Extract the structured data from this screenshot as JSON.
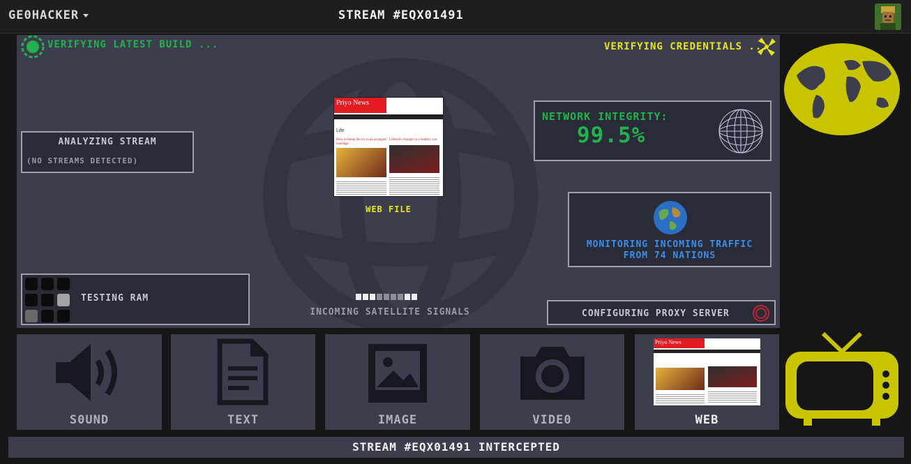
{
  "header": {
    "brand": "GE0HACKER",
    "stream_title": "STREAM #EQX01491"
  },
  "main": {
    "build_status": "VERIFYING LATEST BUILD ...",
    "credentials_status": "VERIFYING CREDENTIALS ...",
    "analyze": {
      "title": "ANALYZING STREAM",
      "detail": "(NO STREAMS DETECTED)"
    },
    "web_file": {
      "label": "WEB FILE",
      "thumb": {
        "site": "Priyo News",
        "section": "Life",
        "headline_1": "How to break the ice in an arranged marriage",
        "headline_2": "Lifestyle changes to a healthy you"
      }
    },
    "network": {
      "label": "NETWORK INTEGRITY:",
      "value": "99.5%"
    },
    "monitor": {
      "line1": "MONITORING INCOMING TRAFFIC",
      "line2": "FROM 74 NATIONS"
    },
    "ram": {
      "label": "TESTING RAM"
    },
    "satellite": {
      "label": "INCOMING SATELLITE SIGNALS"
    },
    "proxy": {
      "label": "CONFIGURING PROXY SERVER"
    }
  },
  "media": {
    "sound": "S0UND",
    "text": "TEXT",
    "image": "IMAGE",
    "video": "VIDE0",
    "web": "WEB"
  },
  "footer": {
    "status": "STREAM #EQX01491 INTERCEPTED"
  },
  "colors": {
    "green": "#22b14c",
    "yellow": "#e6e61a",
    "blue": "#3a8fe8",
    "panel": "#3c3d4d",
    "accent_olive": "#c8c400"
  },
  "icons": {
    "build": "spinning-globe-icon",
    "credentials": "fan-icon",
    "network": "wireframe-sphere-icon",
    "monitor": "earth-icon",
    "proxy": "ring-icon",
    "sound": "speaker-icon",
    "text": "document-icon",
    "image": "picture-icon",
    "video": "camera-icon",
    "side_globe": "world-map-icon",
    "side_tv": "television-icon"
  }
}
